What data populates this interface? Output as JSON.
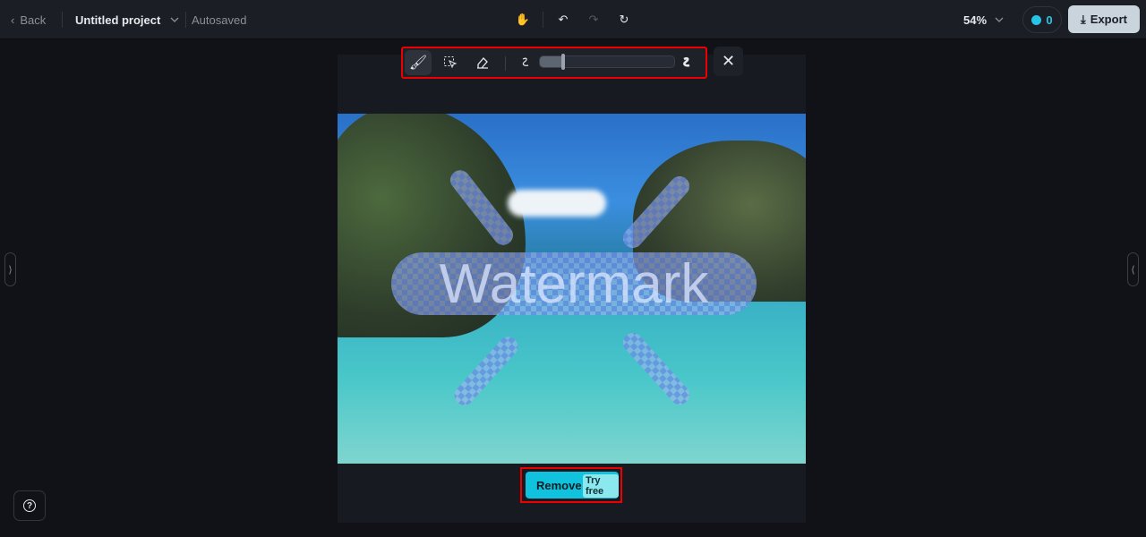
{
  "header": {
    "back_label": "Back",
    "project_title": "Untitled project",
    "save_status": "Autosaved",
    "zoom": "54%",
    "credits": "0",
    "export_label": "Export"
  },
  "toolbar": {
    "tools": [
      "brush-icon",
      "rectangle-select-icon",
      "eraser-icon"
    ],
    "brush_size_fraction": 0.18,
    "close_icon": "close-icon"
  },
  "canvas": {
    "watermark_text": "Watermark"
  },
  "remove": {
    "label": "Remove",
    "cost": "0",
    "badge": "Try free"
  },
  "colors": {
    "accent": "#10c2dd",
    "highlight": "#e00000"
  }
}
